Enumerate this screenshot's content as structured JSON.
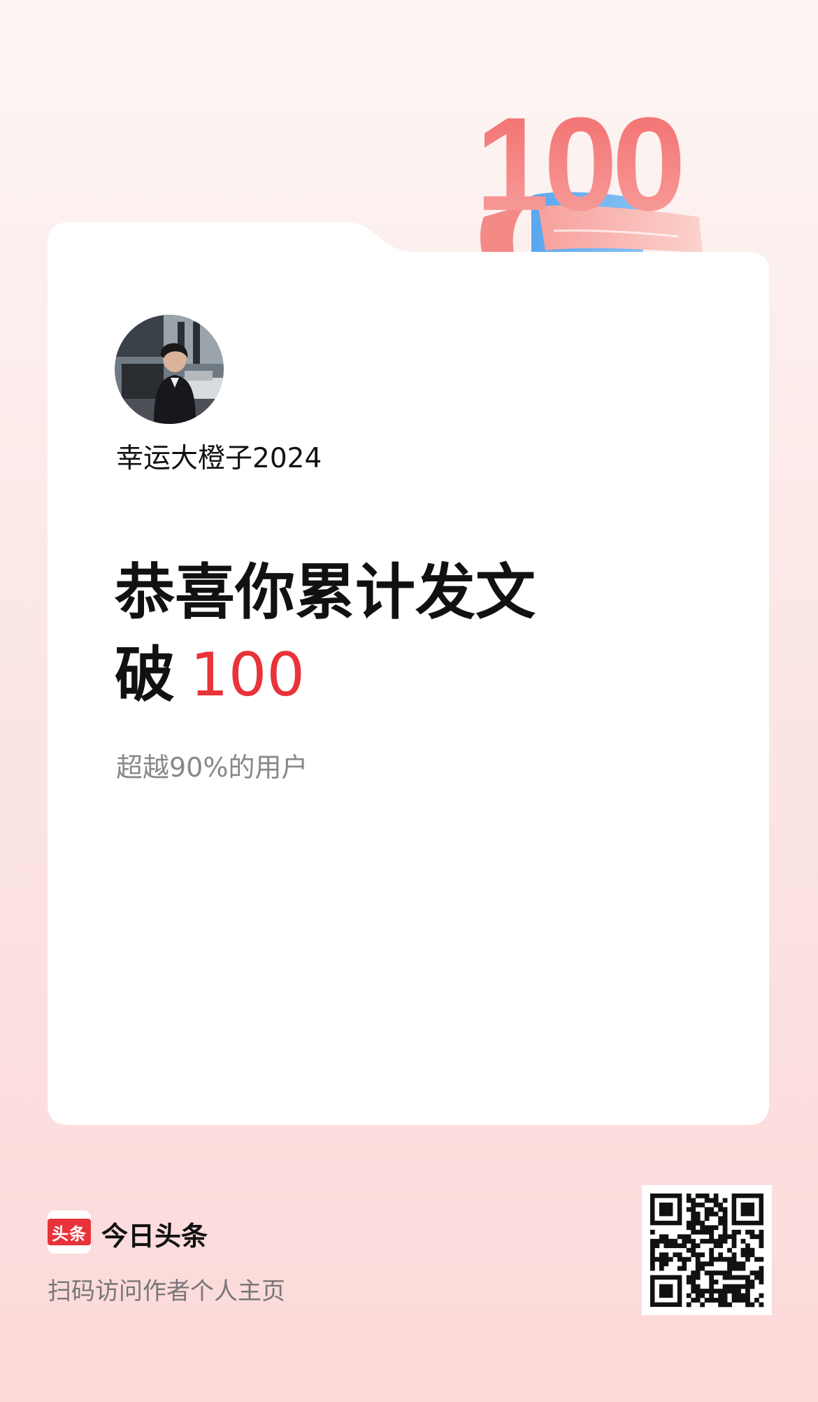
{
  "badge": {
    "number": "100"
  },
  "profile": {
    "username": "幸运大橙子2024"
  },
  "headline": {
    "line1": "恭喜你累计发文",
    "line2_prefix": "破",
    "line2_number": "100"
  },
  "subtext": "超越90%的用户",
  "footer": {
    "app_logo_text": "头条",
    "app_name": "今日头条",
    "scan_text": "扫码访问作者个人主页"
  },
  "colors": {
    "accent": "#e8333a",
    "card": "#ffffff",
    "background_top": "#fdf6f4",
    "background_bottom": "#fcd9d9"
  },
  "icons": [
    "paper-plane-icon",
    "scroll-illustration",
    "qr-code"
  ]
}
